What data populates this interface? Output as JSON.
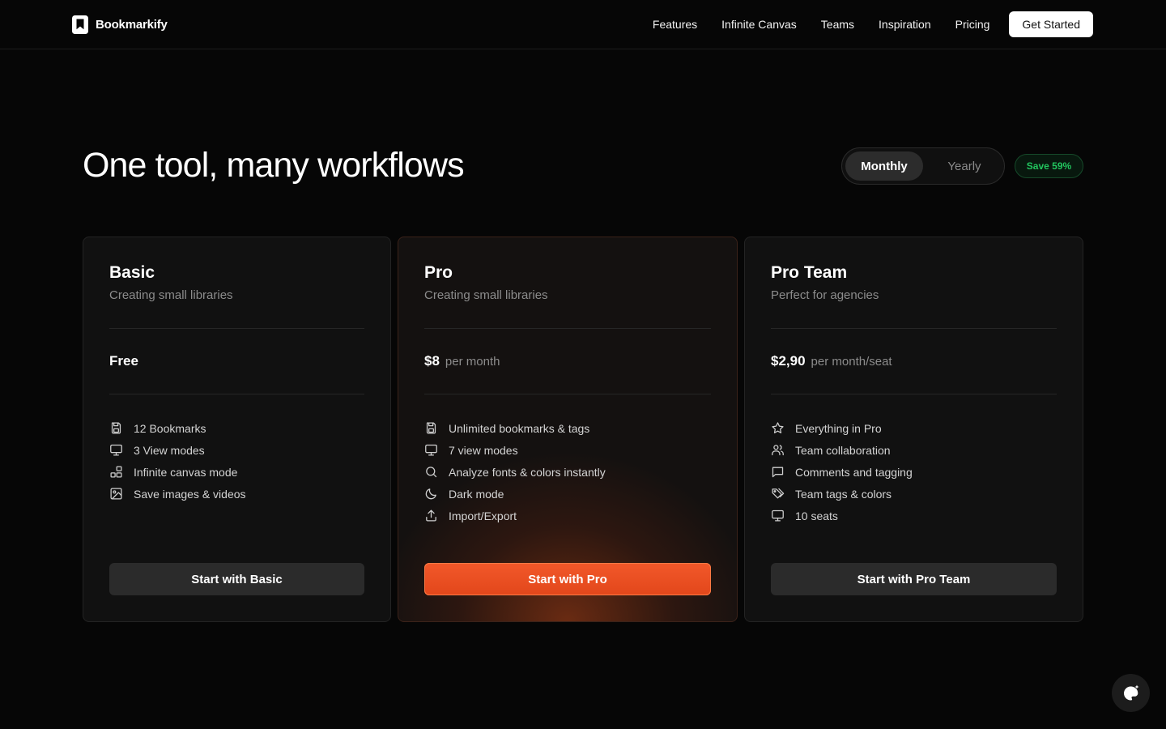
{
  "header": {
    "brand": "Bookmarkify",
    "nav": [
      "Features",
      "Infinite Canvas",
      "Teams",
      "Inspiration",
      "Pricing"
    ],
    "cta": "Get Started"
  },
  "hero": {
    "title": "One tool, many workflows",
    "billing_toggle": {
      "options": [
        "Monthly",
        "Yearly"
      ],
      "selected": "Monthly"
    },
    "save_badge": "Save 59%"
  },
  "plans": [
    {
      "name": "Basic",
      "description": "Creating small libraries",
      "price": "Free",
      "price_unit": "",
      "features": [
        {
          "icon": "save-icon",
          "text": "12 Bookmarks"
        },
        {
          "icon": "monitor-icon",
          "text": "3 View modes"
        },
        {
          "icon": "layout-icon",
          "text": "Infinite canvas mode"
        },
        {
          "icon": "image-icon",
          "text": "Save images & videos"
        }
      ],
      "button": "Start with Basic"
    },
    {
      "name": "Pro",
      "description": "Creating small libraries",
      "price": "$8",
      "price_unit": "per month",
      "features": [
        {
          "icon": "save-icon",
          "text": "Unlimited bookmarks & tags"
        },
        {
          "icon": "monitor-icon",
          "text": "7 view modes"
        },
        {
          "icon": "search-icon",
          "text": "Analyze fonts & colors instantly"
        },
        {
          "icon": "moon-icon",
          "text": "Dark mode"
        },
        {
          "icon": "upload-icon",
          "text": "Import/Export"
        }
      ],
      "button": "Start with Pro"
    },
    {
      "name": "Pro Team",
      "description": "Perfect for agencies",
      "price": "$2,90",
      "price_unit": "per month/seat",
      "features": [
        {
          "icon": "star-icon",
          "text": "Everything in Pro"
        },
        {
          "icon": "users-icon",
          "text": "Team collaboration"
        },
        {
          "icon": "message-icon",
          "text": "Comments and tagging"
        },
        {
          "icon": "tags-icon",
          "text": "Team tags & colors"
        },
        {
          "icon": "monitor-icon",
          "text": "10 seats"
        }
      ],
      "button": "Start with Pro Team"
    }
  ],
  "colors": {
    "background": "#060606",
    "accent": "#e94e20",
    "save_badge": "#22c55e"
  },
  "floating_button": {
    "icon": "palette-sparkle-icon"
  }
}
